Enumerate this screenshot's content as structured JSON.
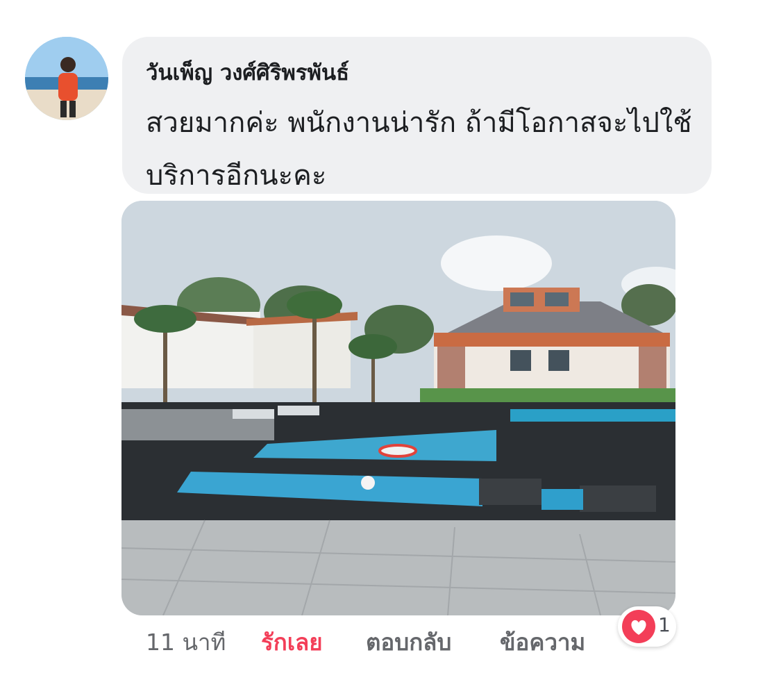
{
  "comment": {
    "author": "วันเพ็ญ วงศ์ศิริพรพันธ์",
    "text": "สวยมากค่ะ พนักงานน่ารัก ถ้ามีโอกาสจะไปใช้บริการอีกนะคะ"
  },
  "photo": {
    "icon": "resort-pool-photo"
  },
  "actions": {
    "time": "11 นาที",
    "love": "รักเลย",
    "reply": "ตอบกลับ",
    "message": "ข้อความ"
  },
  "reactions": {
    "icon": "heart-icon",
    "count": "1"
  },
  "colors": {
    "love_accent": "#f33e58",
    "bubble_bg": "#eff0f2",
    "meta_text": "#65676b"
  }
}
